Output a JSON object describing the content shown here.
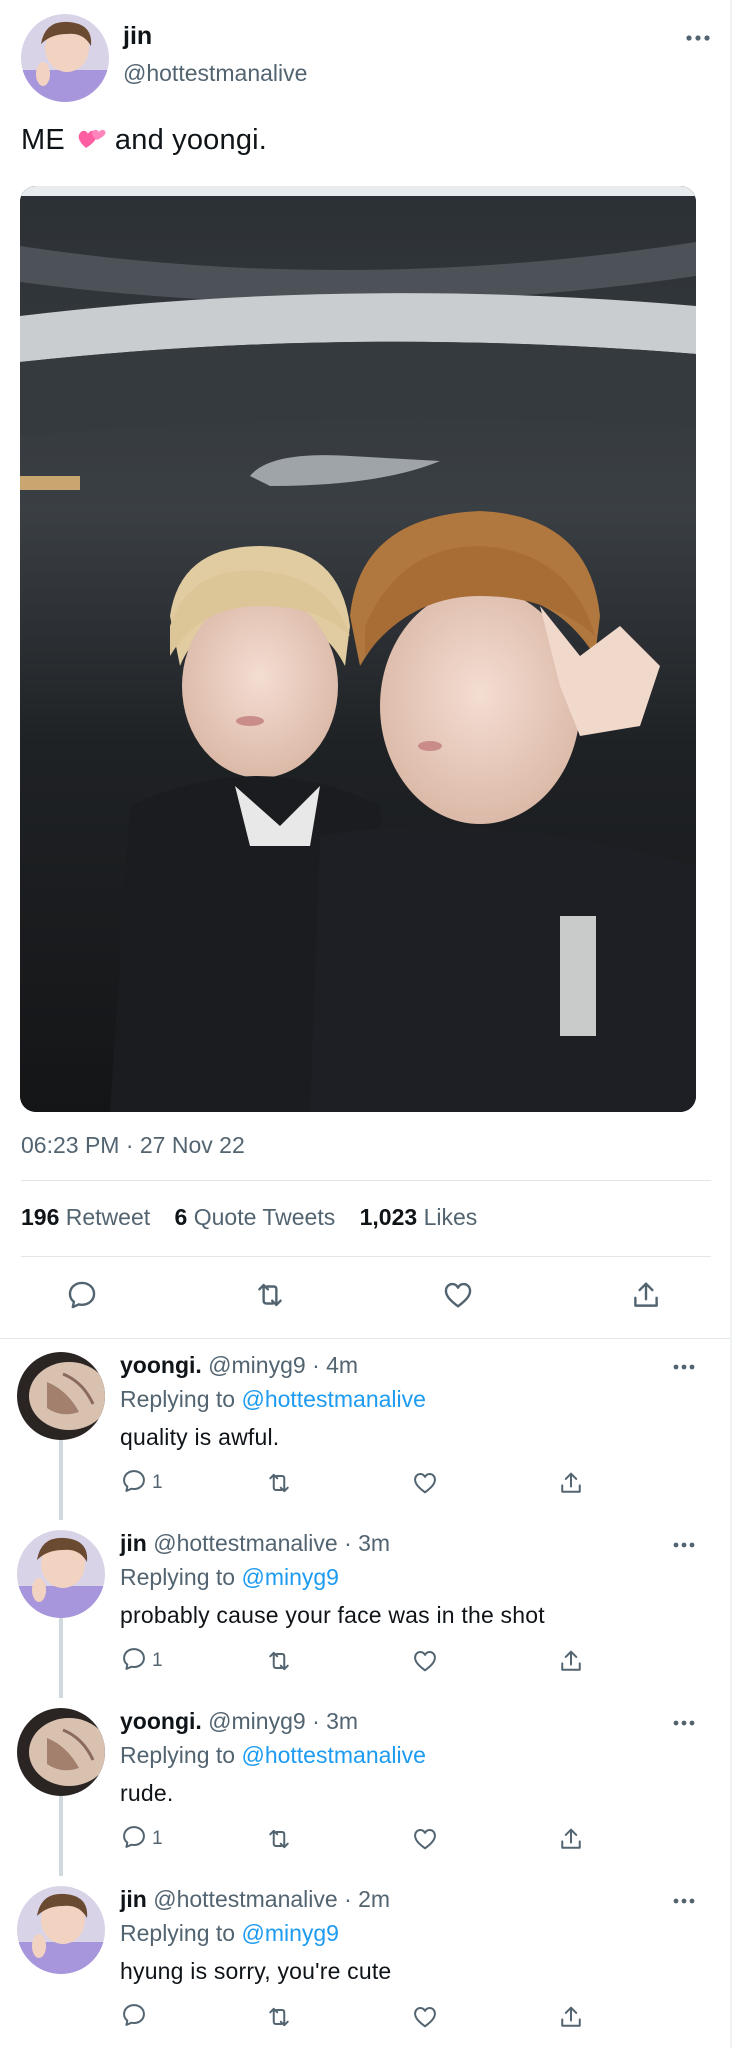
{
  "main_tweet": {
    "author_name": "jin",
    "author_handle": "@hottestmanalive",
    "text_before": "ME",
    "text_after": "and yoongi.",
    "timestamp": "06:23 PM · 27 Nov 22",
    "stats": {
      "retweets_count": "196",
      "retweets_label": "Retweet",
      "quotes_count": "6",
      "quotes_label": "Quote Tweets",
      "likes_count": "1,023",
      "likes_label": "Likes"
    }
  },
  "replies": [
    {
      "name": "yoongi.",
      "handle": "@minyg9",
      "time": "· 4m",
      "replying_label": "Replying to",
      "replying_to": "@hottestmanalive",
      "text": "quality is awful.",
      "reply_count": "1"
    },
    {
      "name": "jin",
      "handle": "@hottestmanalive",
      "time": "· 3m",
      "replying_label": "Replying to",
      "replying_to": "@minyg9",
      "text": "probably cause your face was in the shot",
      "reply_count": "1"
    },
    {
      "name": "yoongi.",
      "handle": "@minyg9",
      "time": "· 3m",
      "replying_label": "Replying to",
      "replying_to": "@hottestmanalive",
      "text": "rude.",
      "reply_count": "1"
    },
    {
      "name": "jin",
      "handle": "@hottestmanalive",
      "time": "· 2m",
      "replying_label": "Replying to",
      "replying_to": "@minyg9",
      "text": "hyung is sorry, you're cute",
      "reply_count": ""
    }
  ],
  "icons": {
    "reply": "reply-icon",
    "retweet": "retweet-icon",
    "like": "heart-icon",
    "share": "share-icon",
    "more": "more-icon",
    "emoji": "two-hearts-emoji"
  },
  "colors": {
    "link": "#1d9bf0",
    "secondary_text": "#536471",
    "primary_text": "#0f1419",
    "divider": "#e1e6e9"
  }
}
